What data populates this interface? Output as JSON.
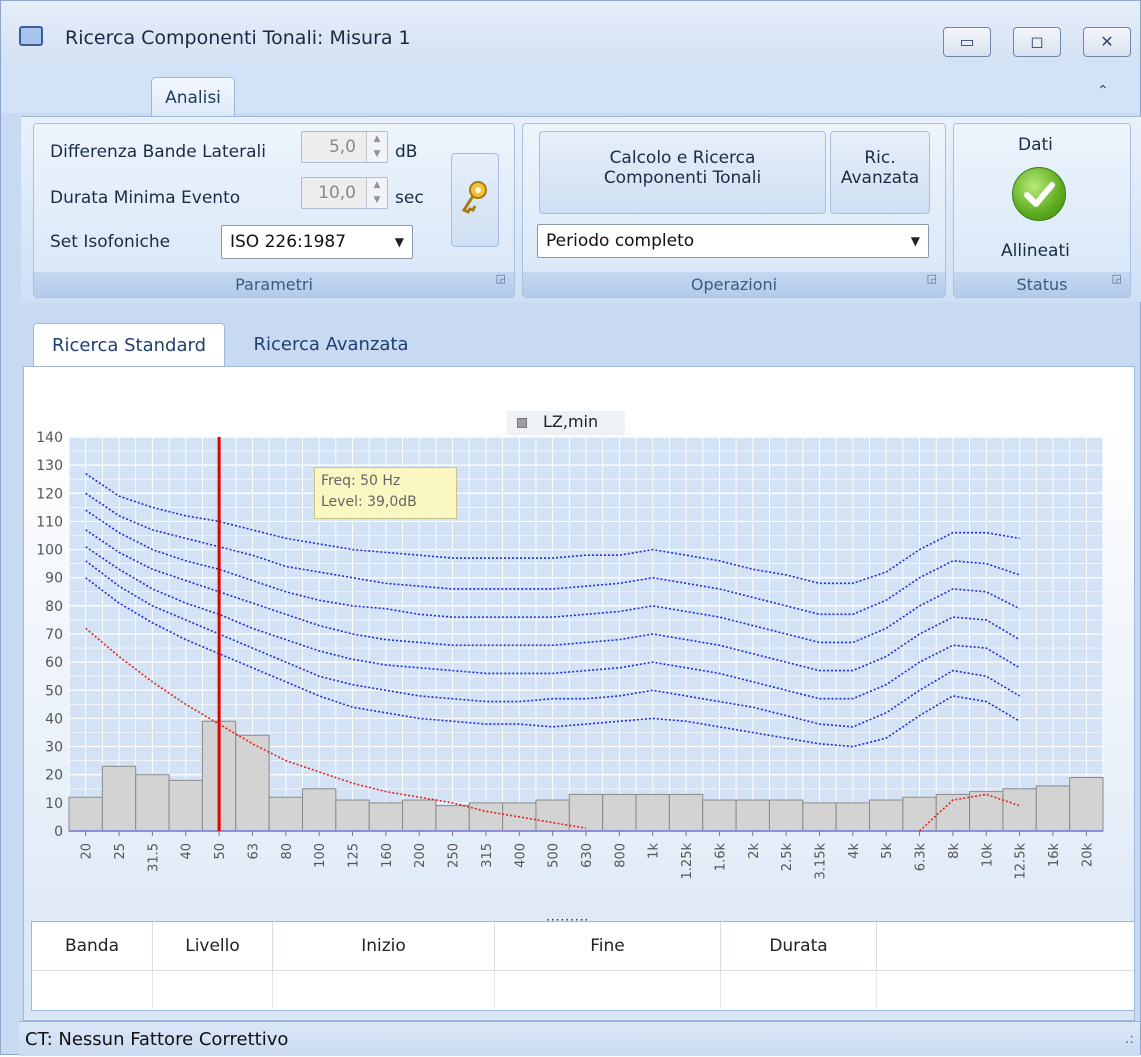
{
  "window": {
    "title": "Ricerca Componenti Tonali: Misura 1",
    "controls": {
      "minimize": "▭",
      "maximize": "◻",
      "close": "✕"
    }
  },
  "ribbon": {
    "tab": "Analisi",
    "collapse_icon": "⌃",
    "parametri": {
      "label": "Parametri",
      "diff_bande_label": "Differenza Bande Laterali",
      "diff_bande_value": "5,0",
      "diff_bande_unit": "dB",
      "durata_label": "Durata Minima Evento",
      "durata_value": "10,0",
      "durata_unit": "sec",
      "isofoniche_label": "Set Isofoniche",
      "isofoniche_value": "ISO 226:1987",
      "key_icon": "key-icon"
    },
    "operazioni": {
      "label": "Operazioni",
      "calcolo_line1": "Calcolo e Ricerca",
      "calcolo_line2": "Componenti Tonali",
      "ric_line1": "Ric.",
      "ric_line2": "Avanzata",
      "periodo_value": "Periodo completo"
    },
    "status": {
      "label": "Status",
      "top": "Dati",
      "bottom": "Allineati",
      "icon": "check-circle-icon"
    }
  },
  "content_tabs": [
    "Ricerca Standard",
    "Ricerca Avanzata"
  ],
  "chart_data": {
    "type": "bar",
    "legend": [
      "LZ,min"
    ],
    "ylim": [
      0,
      140
    ],
    "yticks": [
      0,
      10,
      20,
      30,
      40,
      50,
      60,
      70,
      80,
      90,
      100,
      110,
      120,
      130,
      140
    ],
    "categories": [
      "20",
      "25",
      "31.5",
      "40",
      "50",
      "63",
      "80",
      "100",
      "125",
      "160",
      "200",
      "250",
      "315",
      "400",
      "500",
      "630",
      "800",
      "1k",
      "1.25k",
      "1.6k",
      "2k",
      "2.5k",
      "3.15k",
      "4k",
      "5k",
      "6.3k",
      "8k",
      "10k",
      "12.5k",
      "16k",
      "20k"
    ],
    "series": [
      {
        "name": "LZ,min",
        "values": [
          12,
          23,
          20,
          18,
          39,
          34,
          12,
          15,
          11,
          10,
          11,
          9,
          10,
          10,
          11,
          13,
          13,
          13,
          13,
          11,
          11,
          11,
          10,
          10,
          11,
          12,
          13,
          14,
          15,
          16,
          19
        ]
      }
    ],
    "isophones": [
      [
        127,
        119,
        115,
        112,
        110,
        107,
        104,
        102,
        100,
        99,
        98,
        97,
        97,
        97,
        97,
        98,
        98,
        100,
        98,
        96,
        93,
        91,
        88,
        88,
        92,
        100,
        106,
        106,
        104
      ],
      [
        120,
        112,
        107,
        104,
        101,
        98,
        94,
        92,
        90,
        88,
        87,
        86,
        86,
        86,
        86,
        87,
        88,
        90,
        88,
        86,
        83,
        80,
        77,
        77,
        82,
        90,
        96,
        95,
        91
      ],
      [
        114,
        106,
        100,
        96,
        93,
        89,
        85,
        82,
        80,
        79,
        77,
        76,
        76,
        76,
        76,
        77,
        78,
        80,
        78,
        76,
        73,
        70,
        67,
        67,
        72,
        80,
        86,
        85,
        79
      ],
      [
        107,
        99,
        93,
        89,
        85,
        81,
        77,
        73,
        70,
        68,
        67,
        66,
        66,
        66,
        66,
        67,
        68,
        70,
        68,
        66,
        63,
        60,
        57,
        57,
        62,
        70,
        76,
        75,
        68
      ],
      [
        101,
        93,
        86,
        81,
        77,
        72,
        68,
        64,
        61,
        59,
        58,
        57,
        56,
        56,
        56,
        57,
        58,
        60,
        58,
        56,
        53,
        50,
        47,
        47,
        52,
        60,
        66,
        65,
        58
      ],
      [
        96,
        87,
        80,
        75,
        70,
        65,
        60,
        55,
        52,
        50,
        48,
        47,
        46,
        46,
        47,
        47,
        48,
        50,
        48,
        46,
        44,
        41,
        38,
        37,
        42,
        50,
        57,
        55,
        48
      ],
      [
        90,
        81,
        74,
        68,
        63,
        58,
        53,
        48,
        44,
        42,
        40,
        39,
        38,
        38,
        37,
        38,
        39,
        40,
        39,
        37,
        35,
        33,
        31,
        30,
        33,
        41,
        48,
        46,
        39
      ]
    ],
    "threshold_curve": [
      72,
      62,
      53,
      45,
      38,
      31,
      25,
      21,
      17,
      14,
      12,
      10,
      7,
      5,
      3,
      1,
      null,
      null,
      null,
      null,
      null,
      null,
      null,
      null,
      null,
      0,
      11,
      13,
      9
    ],
    "cursor": {
      "category": "50"
    },
    "tooltip": {
      "line1": "Freq: 50 Hz",
      "line2": "Level:  39,0dB"
    }
  },
  "grid": {
    "splitter": "·········",
    "headers": [
      "Banda",
      "Livello",
      "Inizio",
      "Fine",
      "Durata"
    ]
  },
  "statusbar": {
    "text": "CT: Nessun Fattore Correttivo",
    "grip": ".:"
  }
}
